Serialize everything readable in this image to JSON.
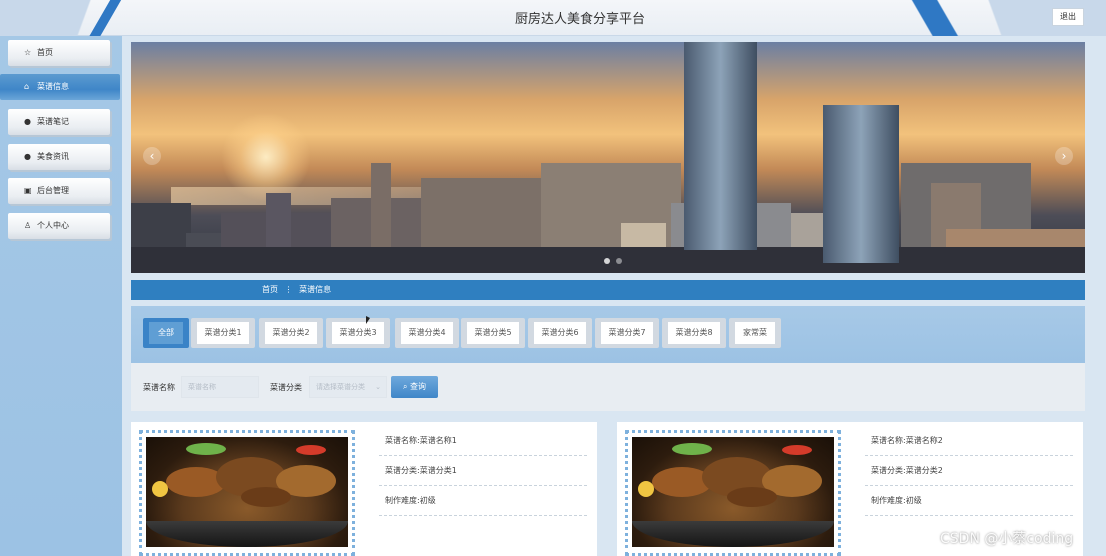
{
  "header": {
    "title": "厨房达人美食分享平台",
    "logout_label": "退出"
  },
  "sidebar": {
    "items": [
      {
        "label": "首页",
        "icon": "star-icon"
      },
      {
        "label": "菜谱信息",
        "icon": "box-icon",
        "active": true
      },
      {
        "label": "菜谱笔记",
        "icon": "info-circle-icon"
      },
      {
        "label": "美食资讯",
        "icon": "question-circle-icon"
      },
      {
        "label": "后台管理",
        "icon": "dashboard-icon"
      },
      {
        "label": "个人中心",
        "icon": "user-icon"
      }
    ]
  },
  "breadcrumb": {
    "home": "首页",
    "separator": "⋮",
    "current": "菜谱信息"
  },
  "categories": [
    {
      "label": "全部",
      "active": true
    },
    {
      "label": "菜谱分类1"
    },
    {
      "label": "菜谱分类2"
    },
    {
      "label": "菜谱分类3"
    },
    {
      "label": "菜谱分类4"
    },
    {
      "label": "菜谱分类5"
    },
    {
      "label": "菜谱分类6"
    },
    {
      "label": "菜谱分类7"
    },
    {
      "label": "菜谱分类8"
    },
    {
      "label": "家常菜"
    }
  ],
  "search": {
    "name_label": "菜谱名称",
    "name_placeholder": "菜谱名称",
    "category_label": "菜谱分类",
    "category_placeholder": "请选择菜谱分类",
    "button_label": "查询"
  },
  "cards": [
    {
      "name_line": "菜谱名称:菜谱名称1",
      "category_line": "菜谱分类:菜谱分类1",
      "difficulty_line": "制作难度:初级"
    },
    {
      "name_line": "菜谱名称:菜谱名称2",
      "category_line": "菜谱分类:菜谱分类2",
      "difficulty_line": "制作难度:初级"
    }
  ],
  "watermark": "CSDN @小蔡coding",
  "colors": {
    "accent": "#2f7fc0",
    "sidebar": "#9cc2e4",
    "active_nav": "#3f86c8"
  }
}
